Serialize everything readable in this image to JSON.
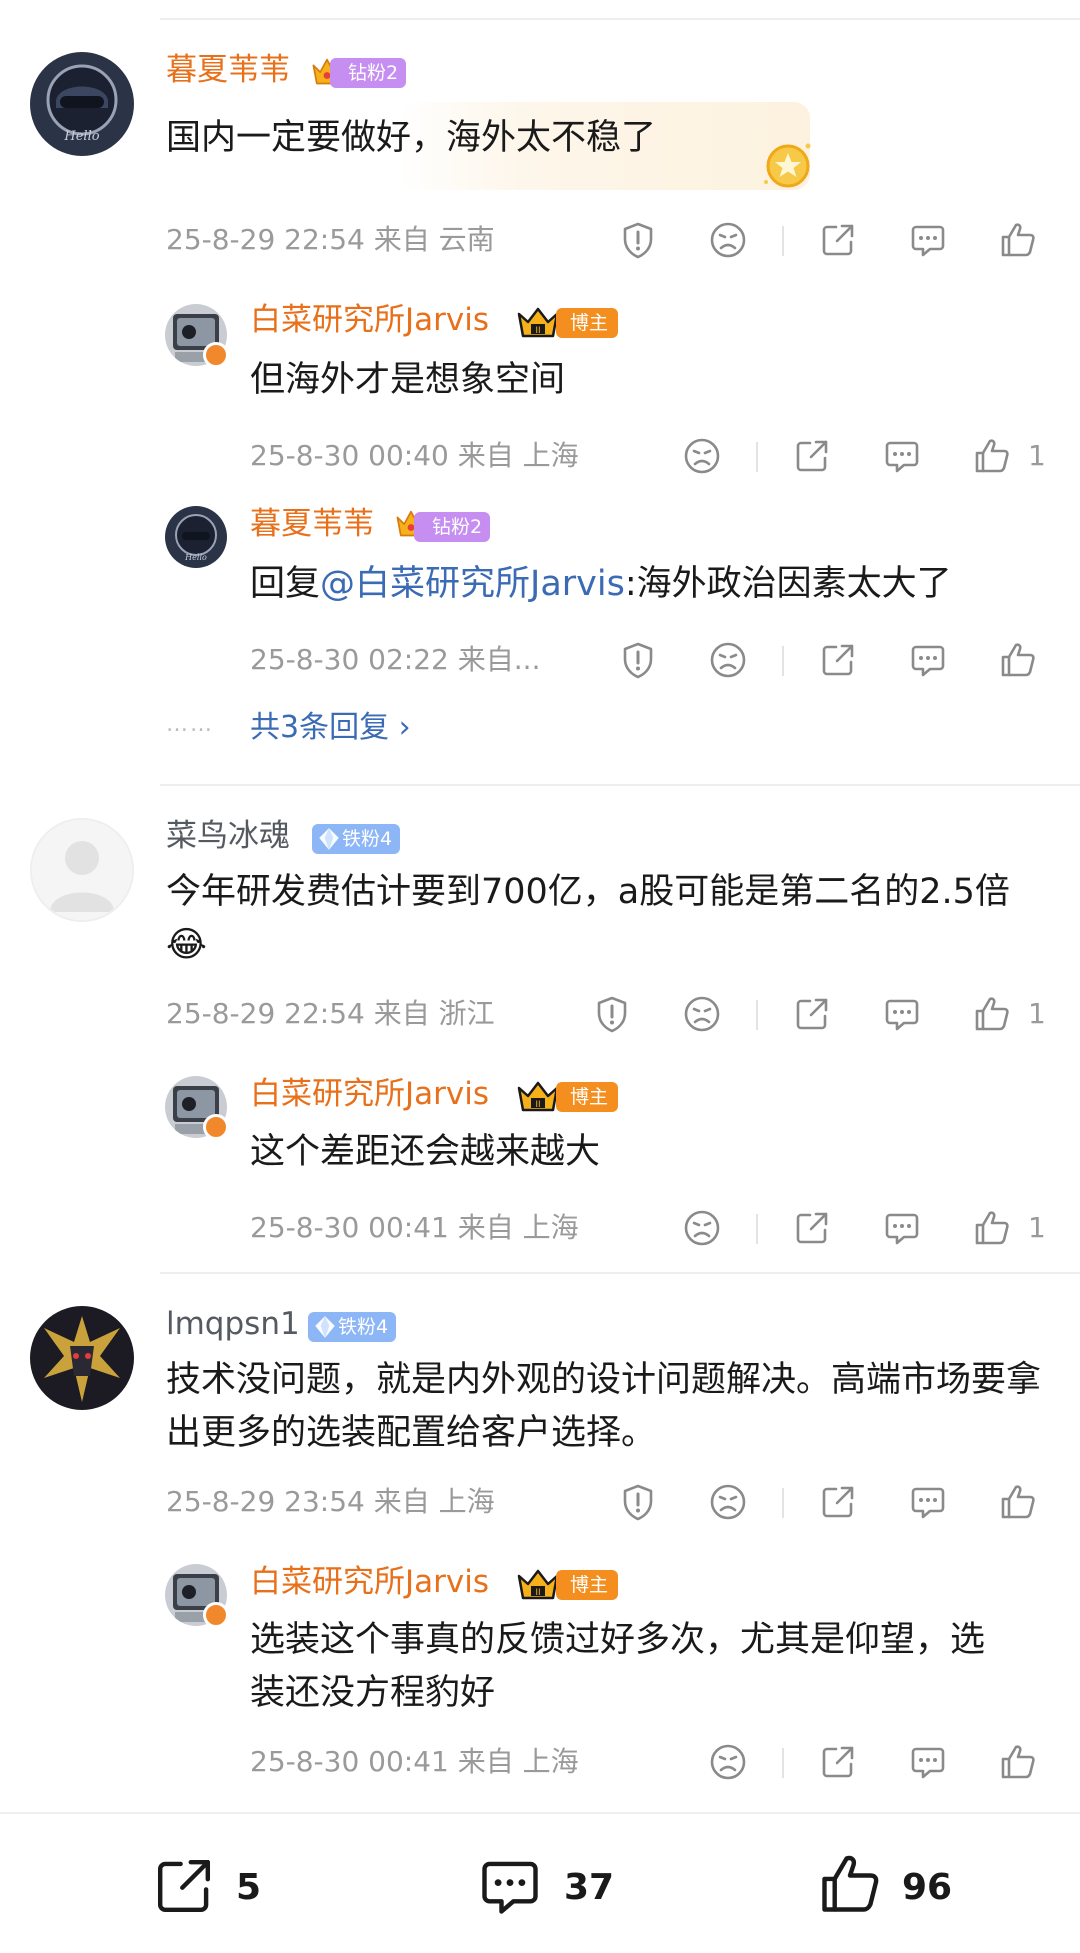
{
  "comments": [
    {
      "user": "暮夏苇苇",
      "badge": "钻粉2",
      "text": "国内一定要做好，海外太不稳了",
      "time": "25-8-29 22:54",
      "location": "来自 云南",
      "replies": [
        {
          "user": "白菜研究所Jarvis",
          "badge": "博主",
          "text": "但海外才是想象空间",
          "time": "25-8-30 00:40",
          "location": "来自 上海",
          "like_count": "1"
        },
        {
          "user": "暮夏苇苇",
          "badge": "钻粉2",
          "text_prefix": "回复",
          "mention": "@白菜研究所Jarvis",
          "text": ":海外政治因素太大了",
          "time": "25-8-30 02:22",
          "location": "来自..."
        }
      ],
      "more_replies": "共3条回复 ›",
      "more_dots": "……"
    },
    {
      "user": "菜鸟冰魂",
      "badge": "铁粉4",
      "text": "今年研发费估计要到700亿，a股可能是第二名的2.5倍😂",
      "time": "25-8-29 22:54",
      "location": "来自 浙江",
      "like_count": "1",
      "replies": [
        {
          "user": "白菜研究所Jarvis",
          "badge": "博主",
          "text": "这个差距还会越来越大",
          "time": "25-8-30 00:41",
          "location": "来自 上海",
          "like_count": "1"
        }
      ]
    },
    {
      "user": "lmqpsn1",
      "badge": "铁粉4",
      "text": "技术没问题，就是内外观的设计问题解决。高端市场要拿出更多的选装配置给客户选择。",
      "time": "25-8-29 23:54",
      "location": "来自 上海",
      "replies": [
        {
          "user": "白菜研究所Jarvis",
          "badge": "博主",
          "text": "选装这个事真的反馈过好多次，尤其是仰望，选装还没方程豹好",
          "time": "25-8-30 00:41",
          "location": "来自 上海"
        }
      ]
    }
  ],
  "bottom_bar": {
    "share_count": "5",
    "comment_count": "37",
    "like_count": "96"
  },
  "colors": {
    "username_orange": "#e8701a",
    "mention_blue": "#3b6bb4",
    "meta_gray": "#9a9a9a",
    "badge_purple": "#c58ef0",
    "badge_blue": "#8cb6f5",
    "badge_blogger": "#f48e1e"
  }
}
